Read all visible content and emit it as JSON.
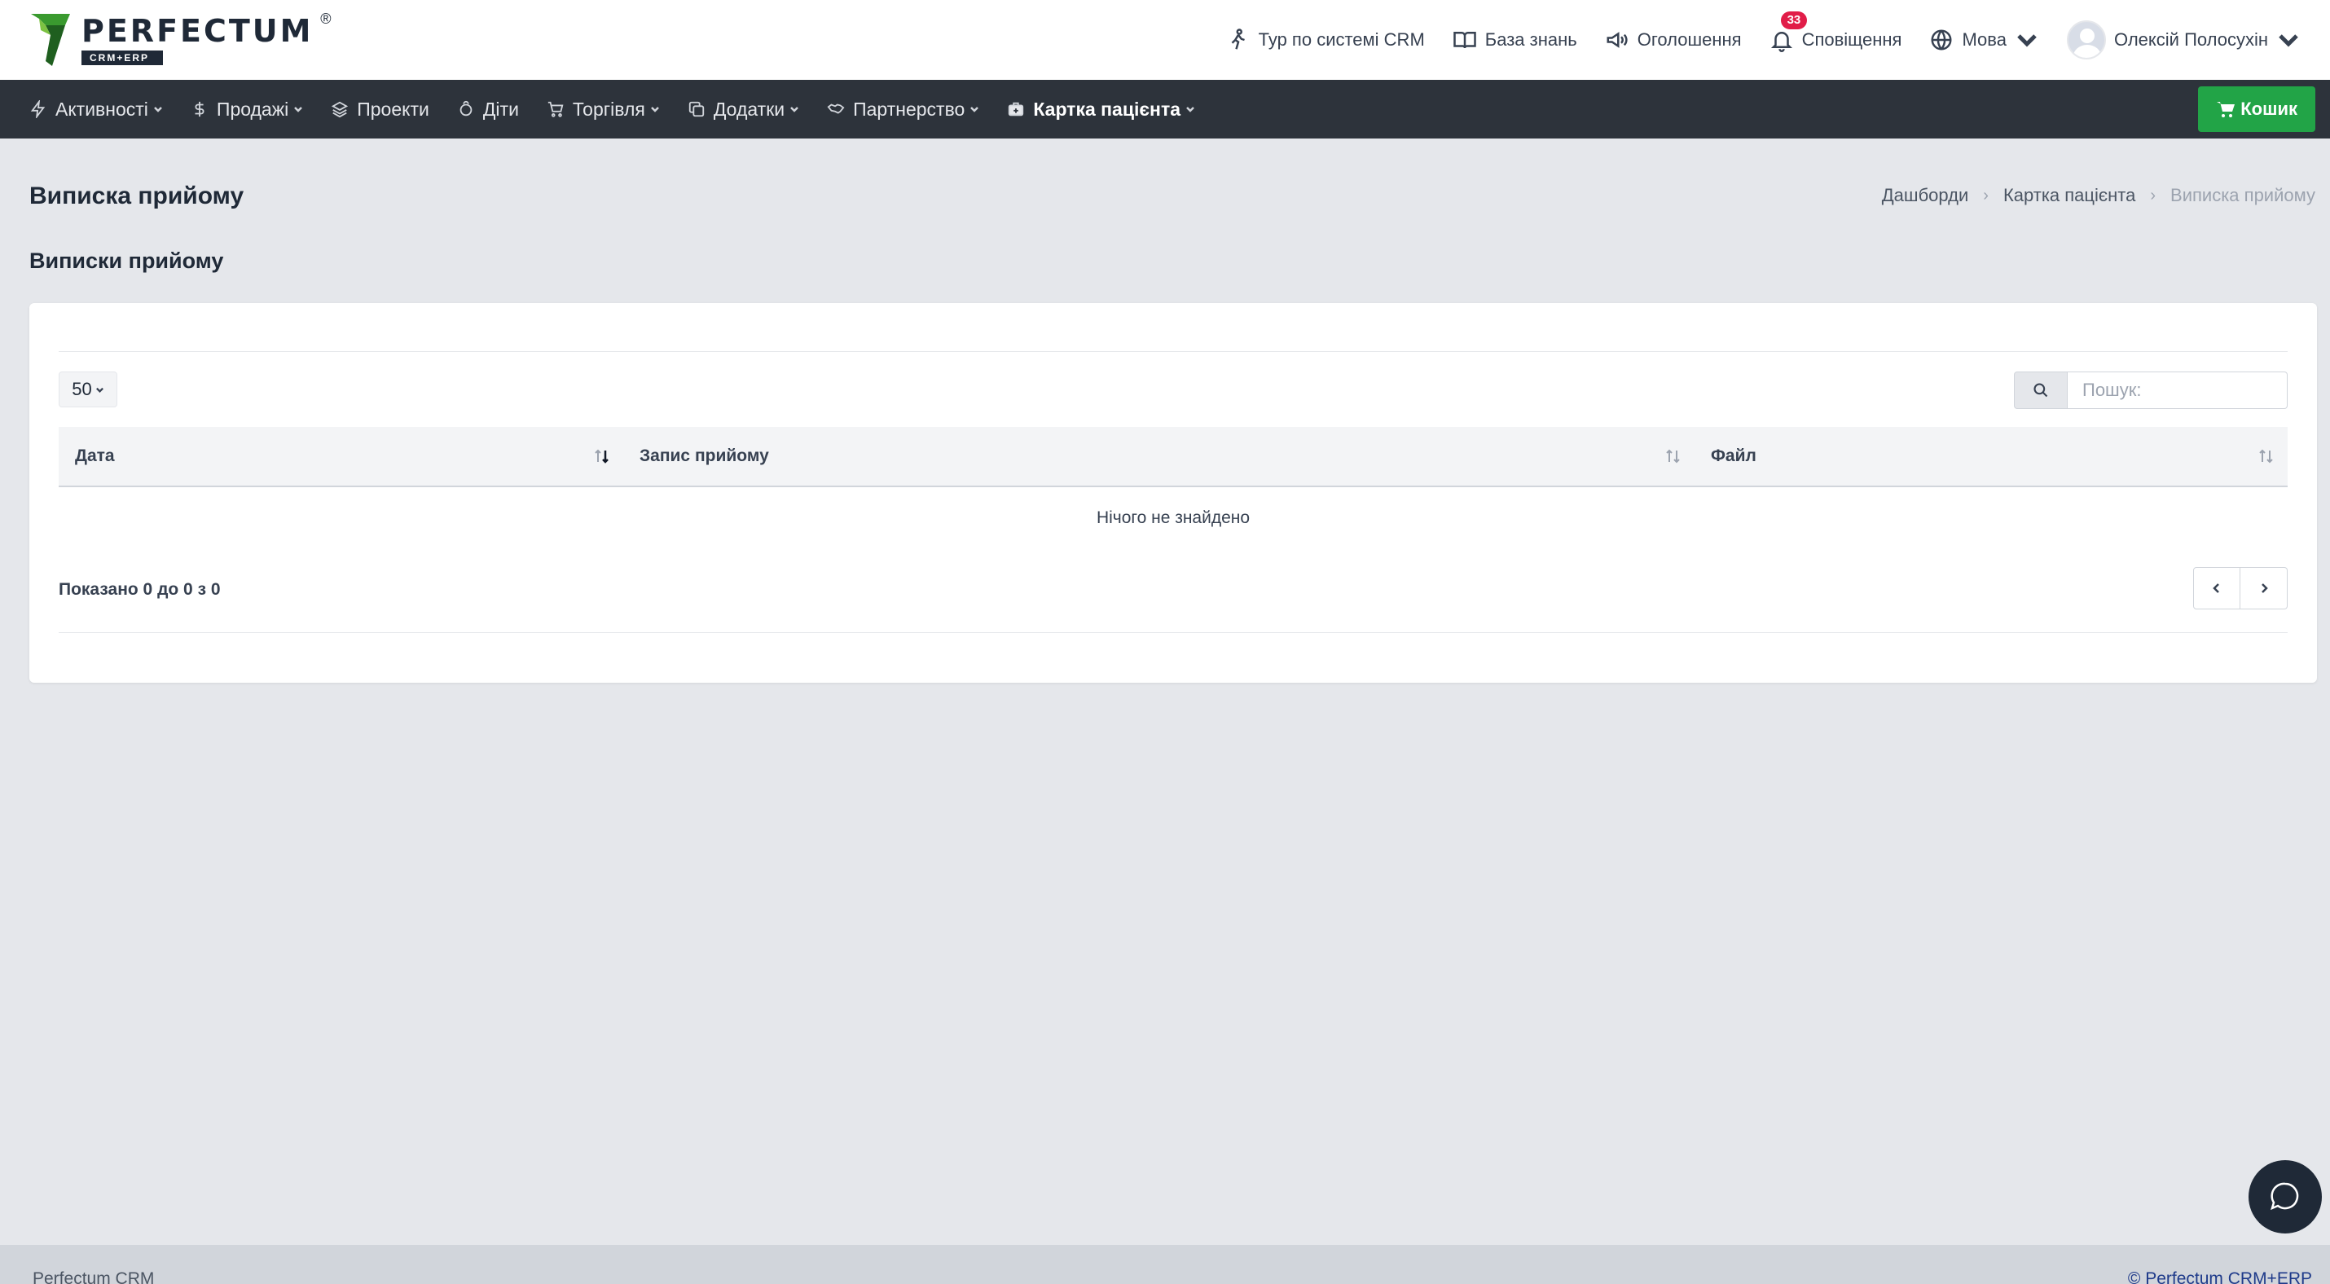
{
  "brand": {
    "name": "PERFECTUM",
    "sub": "CRM+ERP",
    "reg": "®",
    "colors": {
      "green": "#2e8b2e",
      "dark": "#1f2937"
    }
  },
  "header": {
    "tour": "Тур по системі CRM",
    "knowledge": "База знань",
    "announcements": "Оголошення",
    "notifications": "Сповіщення",
    "notifications_count": "33",
    "language": "Мова",
    "user_name": "Олексій Полосухін"
  },
  "nav": {
    "items": [
      {
        "label": "Активності",
        "icon": "bolt-icon",
        "dropdown": true
      },
      {
        "label": "Продажі",
        "icon": "dollar-icon",
        "dropdown": true
      },
      {
        "label": "Проекти",
        "icon": "layers-icon",
        "dropdown": false
      },
      {
        "label": "Діти",
        "icon": "child-icon",
        "dropdown": false
      },
      {
        "label": "Торгівля",
        "icon": "cart-icon",
        "dropdown": true
      },
      {
        "label": "Додатки",
        "icon": "copy-icon",
        "dropdown": true
      },
      {
        "label": "Партнерство",
        "icon": "handshake-icon",
        "dropdown": true
      },
      {
        "label": "Картка пацієнта",
        "icon": "medkit-icon",
        "dropdown": true,
        "active": true
      }
    ],
    "cart_label": "Кошик",
    "colors": {
      "bar": "#2d333b",
      "cart": "#22a447"
    }
  },
  "page": {
    "title": "Виписка прийому",
    "breadcrumb": [
      "Дашборди",
      "Картка пацієнта",
      "Виписка прийому"
    ],
    "section_title": "Виписки прийому"
  },
  "table": {
    "page_length": "50",
    "search_placeholder": "Пошук:",
    "columns": [
      "Дата",
      "Запис прийому",
      "Файл"
    ],
    "rows": [],
    "empty_text": "Нічого не знайдено",
    "info": "Показано 0 до 0 з 0"
  },
  "footer": {
    "left": "Perfectum CRM",
    "right": "© Perfectum CRM+ERP"
  }
}
